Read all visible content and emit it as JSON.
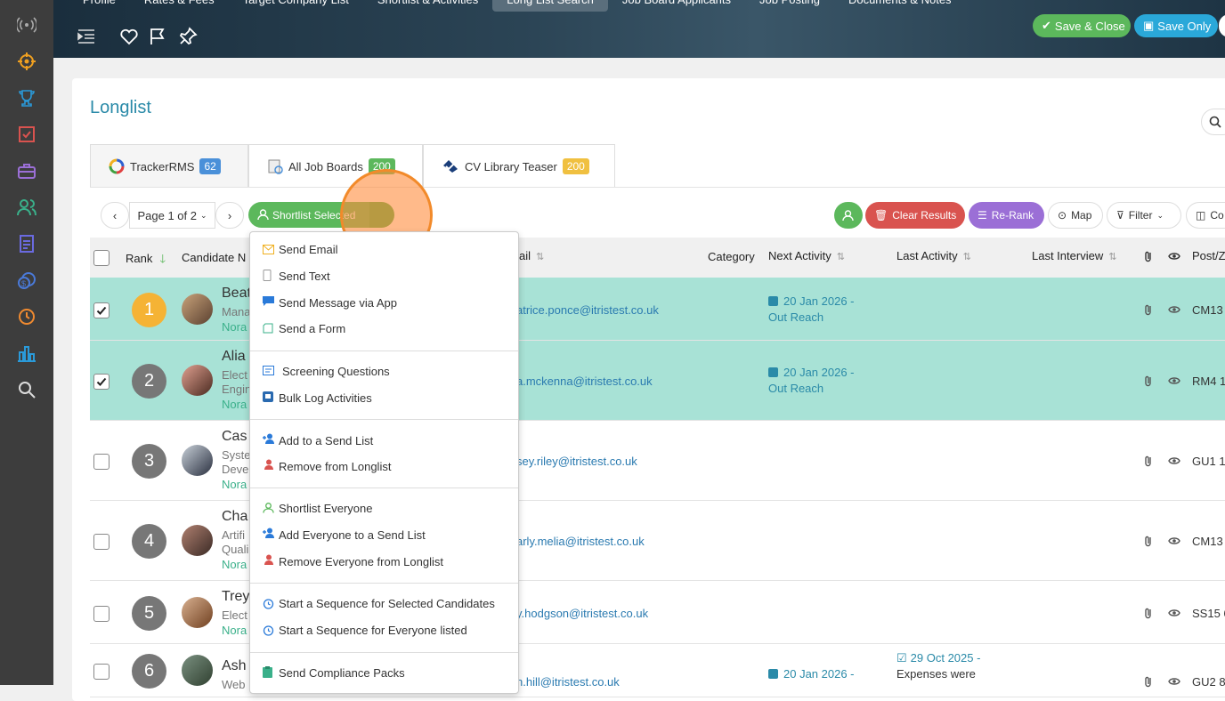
{
  "topbar": {
    "tabs": [
      "Profile",
      "Rates & Fees",
      "Target Company List",
      "Shortlist & Activities",
      "Long List Search",
      "Job Board Applicants",
      "Job Posting",
      "Documents & Notes"
    ],
    "save_close": "Save & Close",
    "save_only": "Save Only"
  },
  "page": {
    "title": "Longlist"
  },
  "sources": [
    {
      "label": "TrackerRMS",
      "count": "62",
      "color": "#4a90d9"
    },
    {
      "label": "All Job Boards",
      "count": "200",
      "color": "#5cb85c"
    },
    {
      "label": "CV Library Teaser",
      "count": "200",
      "color": "#f0c040"
    }
  ],
  "toolbar": {
    "prev": "‹",
    "page": "Page 1 of 2",
    "next": "›",
    "shortlist": "Shortlist Selected",
    "clear": "Clear Results",
    "rerank": "Re-Rank",
    "map": "Map",
    "filter": "Filter",
    "columns": "Co"
  },
  "columns": {
    "rank": "Rank",
    "candidate": "Candidate N",
    "email": "ail",
    "category": "Category",
    "next_activity": "Next Activity",
    "last_activity": "Last Activity",
    "last_interview": "Last Interview",
    "post": "Post/Z"
  },
  "rows": [
    {
      "rank": "1",
      "name": "Beat",
      "sub": "Mana",
      "nora": "Nora",
      "email": "atrice.ponce@itristest.co.uk",
      "next": "20 Jan 2026 -",
      "next2": "Out Reach",
      "last": "",
      "last2": "",
      "post": "CM13",
      "checked": true
    },
    {
      "rank": "2",
      "name": "Alia",
      "sub": "Elect",
      "sub2": "Engin",
      "nora": "Nora",
      "email": "a.mckenna@itristest.co.uk",
      "next": "20 Jan 2026 -",
      "next2": "Out Reach",
      "last": "",
      "last2": "",
      "post": "RM4 1",
      "checked": true
    },
    {
      "rank": "3",
      "name": "Cas",
      "sub": "Syste",
      "sub2": "Deve",
      "nora": "Nora",
      "email": "sey.riley@itristest.co.uk",
      "next": "",
      "next2": "",
      "last": "",
      "last2": "",
      "post": "GU1 1",
      "checked": false
    },
    {
      "rank": "4",
      "name": "Cha",
      "sub": "Artifi",
      "sub2": "Quali",
      "nora": "Nora",
      "email": "arly.melia@itristest.co.uk",
      "next": "",
      "next2": "",
      "last": "",
      "last2": "",
      "post": "CM13",
      "checked": false
    },
    {
      "rank": "5",
      "name": "Trey",
      "sub": "Elect",
      "nora": "Nora",
      "email": "y.hodgson@itristest.co.uk",
      "next": "",
      "next2": "",
      "last": "",
      "last2": "",
      "post": "SS15 6",
      "checked": false
    },
    {
      "rank": "6",
      "name": "Ash",
      "sub": "Web",
      "nora": "",
      "email": "n.hill@itristest.co.uk",
      "next": "20 Jan 2026 -",
      "next2": "",
      "last": "29 Oct 2025 -",
      "last2": "Expenses were",
      "post": "GU2 8",
      "checked": false
    }
  ],
  "menu": {
    "items": [
      "Send Email",
      "Send Text",
      "Send Message via App",
      "Send a Form",
      "Screening Questions",
      "Bulk Log Activities",
      "Add to a Send List",
      "Remove from Longlist",
      "Shortlist Everyone",
      "Add Everyone to a Send List",
      "Remove Everyone from Longlist",
      "Start a Sequence for Selected Candidates",
      "Start a Sequence for Everyone listed",
      "Send Compliance Packs"
    ]
  },
  "colors": {
    "accent": "#2a8aa8",
    "green": "#5cb85c",
    "red": "#d9534f",
    "purple": "#9b6fd6",
    "selected_row": "#a8e2d6"
  }
}
